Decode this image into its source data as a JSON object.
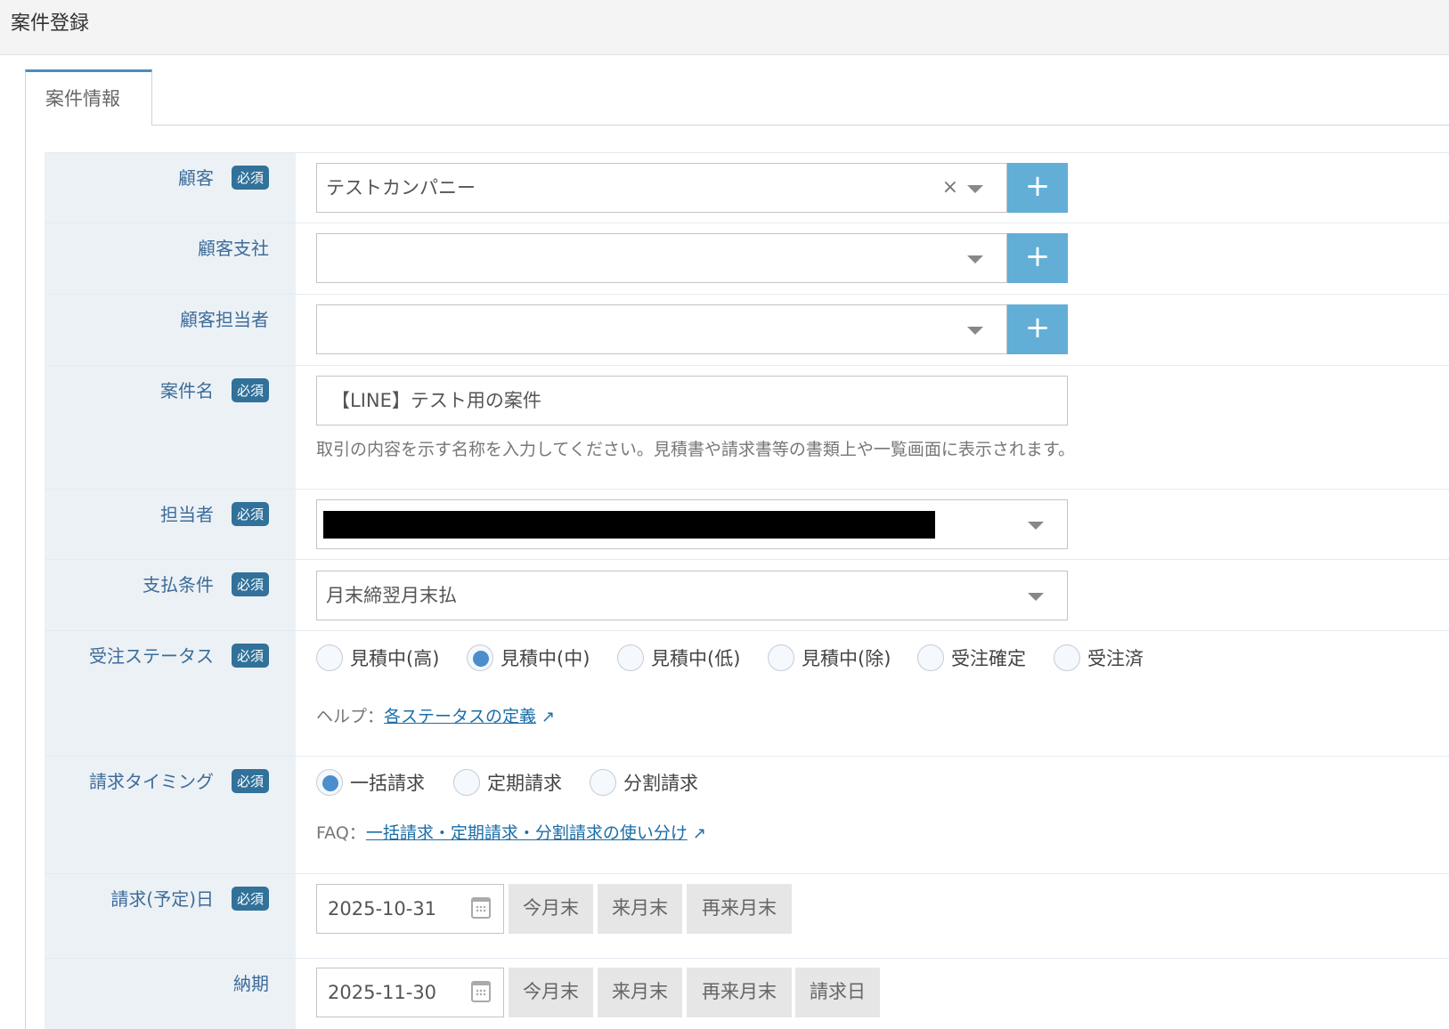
{
  "header": {
    "title": "案件登録"
  },
  "tab": {
    "label": "案件情報"
  },
  "required": "必須",
  "fields": {
    "customer": {
      "label": "顧客",
      "value": "テストカンパニー",
      "clear": "×",
      "add": "+"
    },
    "branch": {
      "label": "顧客支社",
      "value": "",
      "add": "+"
    },
    "contact": {
      "label": "顧客担当者",
      "value": "",
      "add": "+"
    },
    "name": {
      "label": "案件名",
      "value": "【LINE】テスト用の案件",
      "help": "取引の内容を示す名称を入力してください。見積書や請求書等の書類上や一覧画面に表示されます。"
    },
    "owner": {
      "label": "担当者"
    },
    "payment": {
      "label": "支払条件",
      "value": "月末締翌月末払"
    },
    "status": {
      "label": "受注ステータス",
      "options": [
        "見積中(高)",
        "見積中(中)",
        "見積中(低)",
        "見積中(除)",
        "受注確定",
        "受注済"
      ],
      "selected": "見積中(中)",
      "help_prefix": "ヘルプ：",
      "help_link": "各ステータスの定義"
    },
    "timing": {
      "label": "請求タイミング",
      "options": [
        "一括請求",
        "定期請求",
        "分割請求"
      ],
      "selected": "一括請求",
      "faq_prefix": "FAQ：",
      "faq_link": "一括請求・定期請求・分割請求の使い分け"
    },
    "billing_date": {
      "label": "請求(予定)日",
      "value": "2025-10-31",
      "buttons": [
        "今月末",
        "来月末",
        "再来月末"
      ]
    },
    "delivery": {
      "label": "納期",
      "value": "2025-11-30",
      "buttons": [
        "今月末",
        "来月末",
        "再来月末",
        "請求日"
      ]
    }
  }
}
